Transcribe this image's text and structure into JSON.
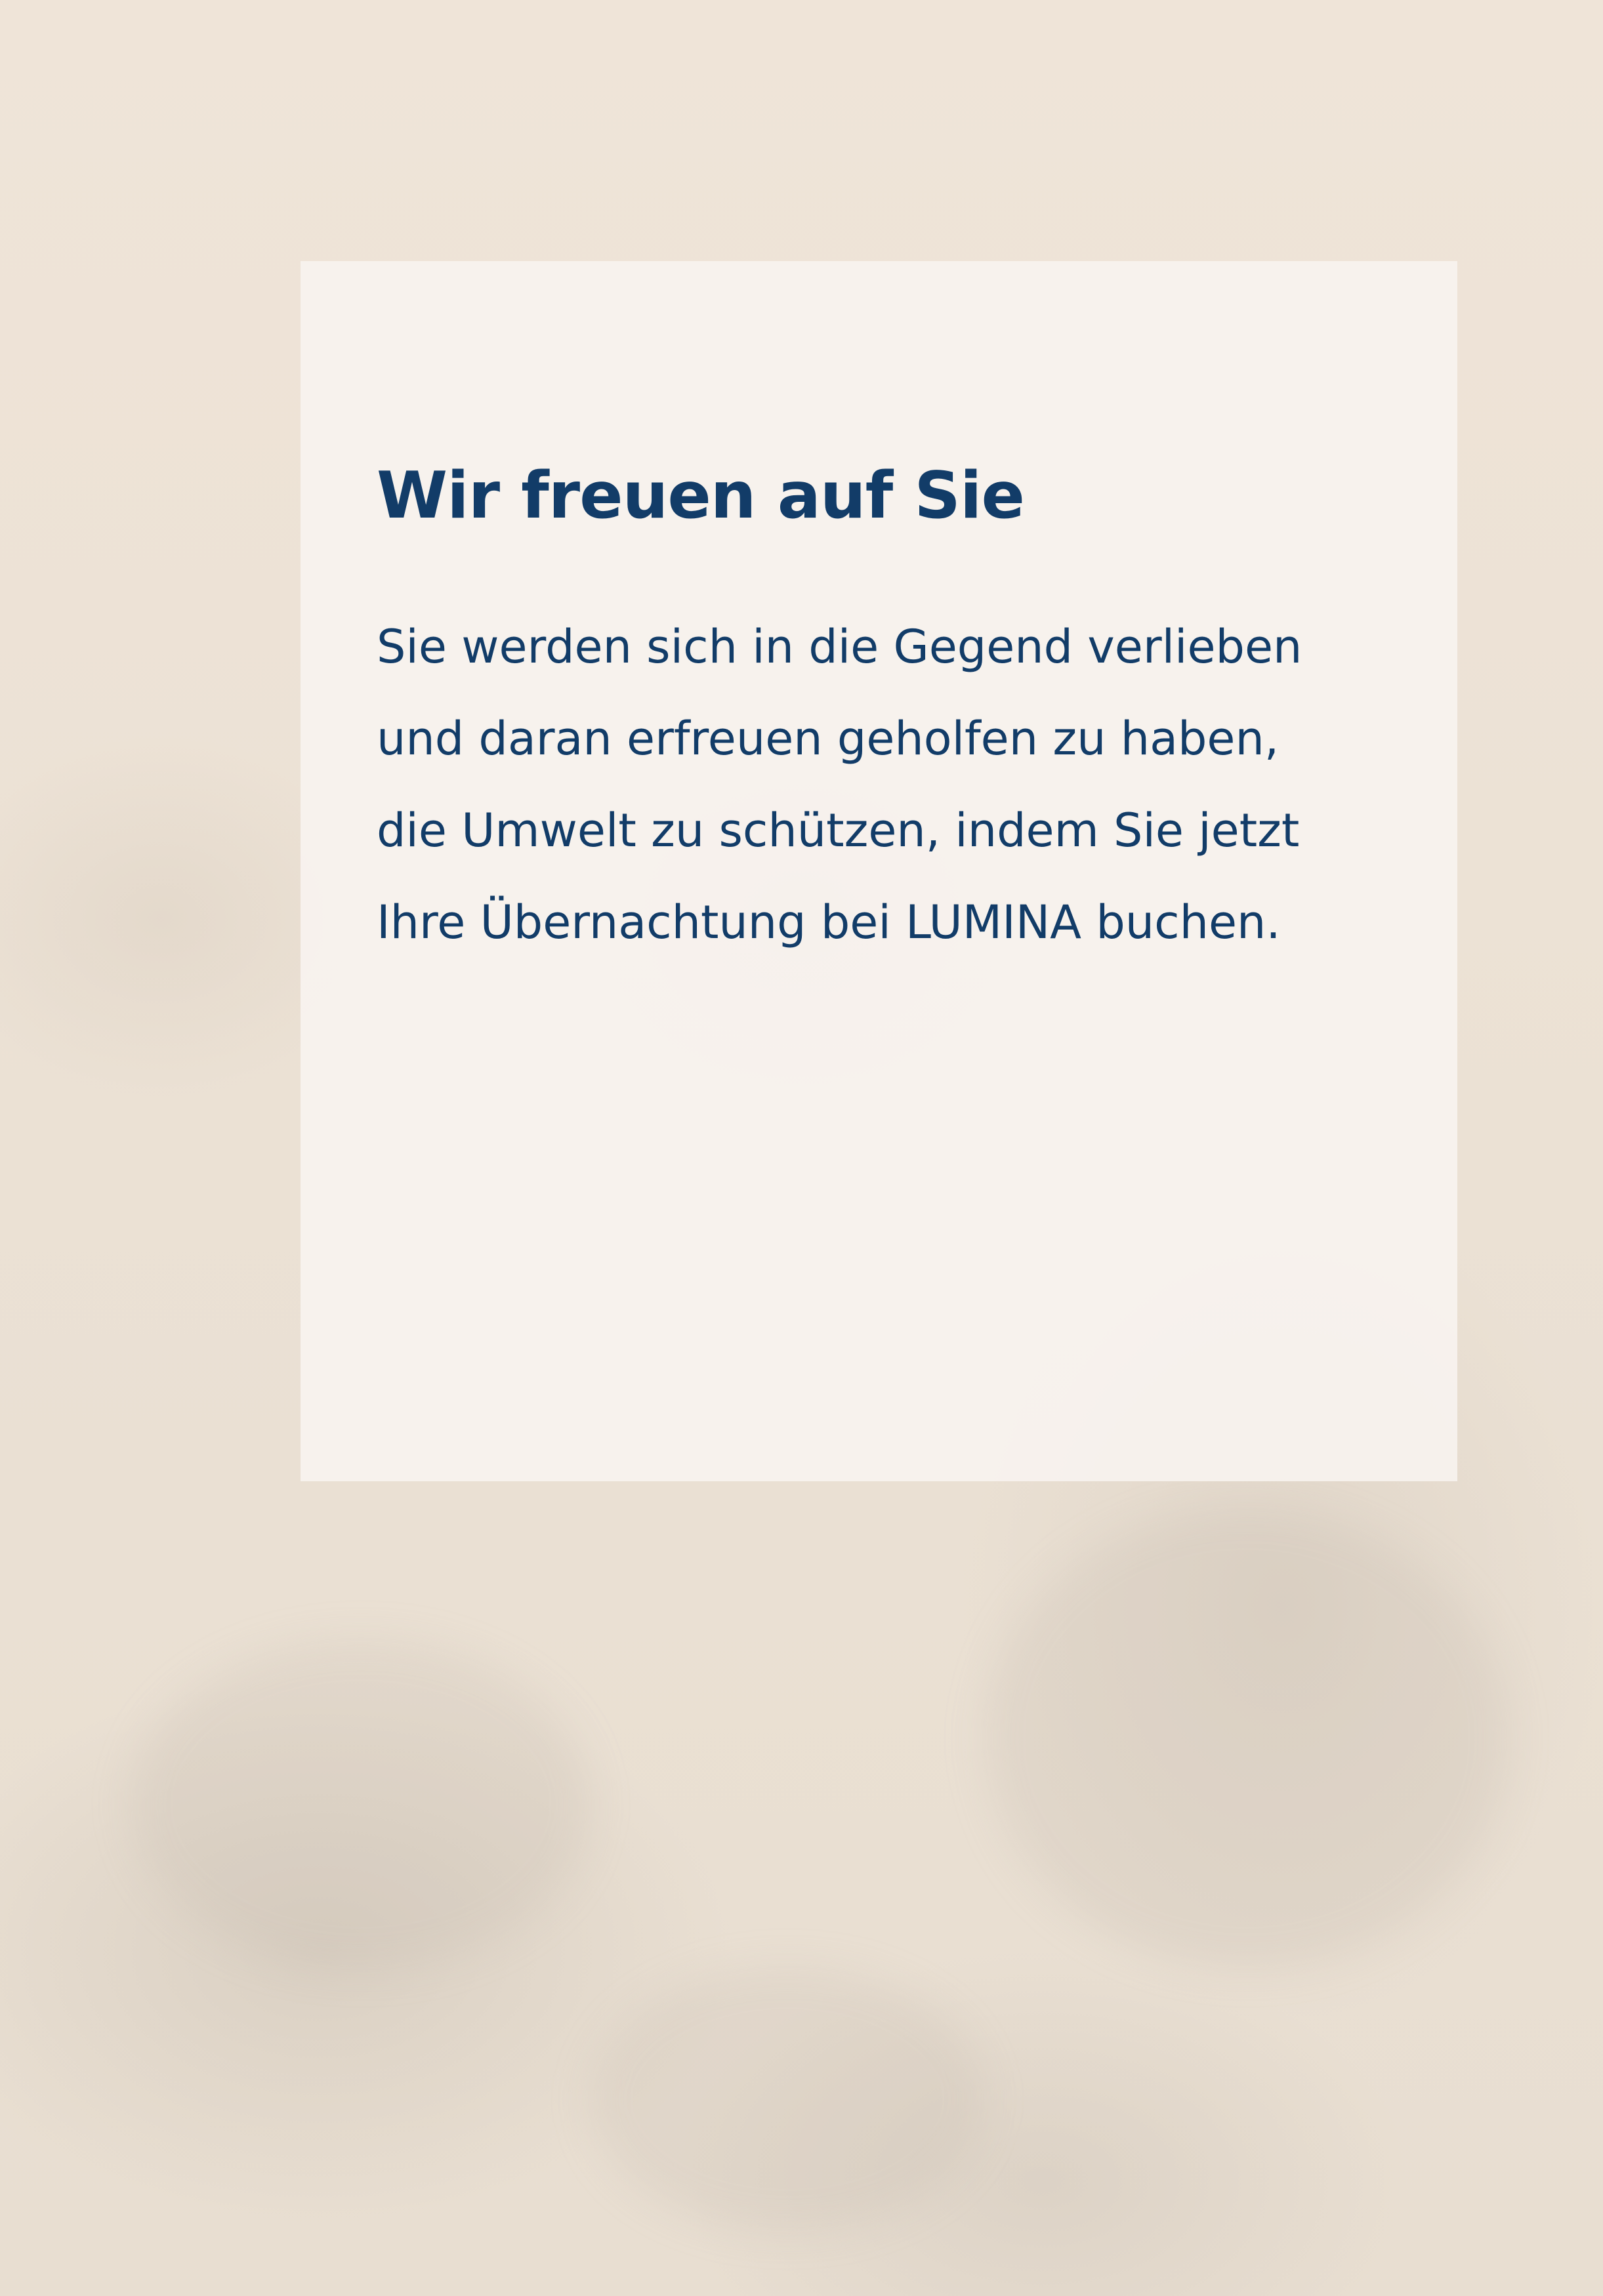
{
  "page": {
    "heading": "Wir freuen auf Sie",
    "body_lines": [
      "Sie werden sich in die Gegend verlieben",
      "und daran erfreuen geholfen zu haben,",
      "die Umwelt zu schützen, indem Sie jetzt",
      "Ihre Übernachtung bei LUMINA buchen."
    ]
  },
  "colors": {
    "text": "#123c68",
    "panel": "#f8f4f0",
    "background": "#eee4d8"
  }
}
